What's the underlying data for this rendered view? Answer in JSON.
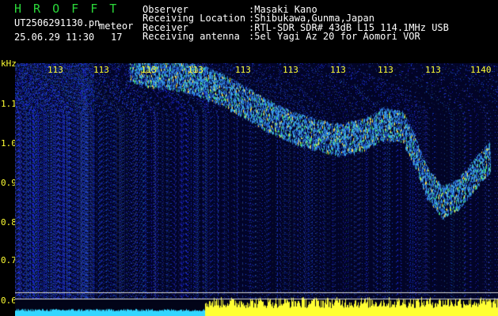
{
  "header": {
    "logo": "H R O F F T",
    "file_name": "UT2506291130.pn",
    "file_suffix": "meteor",
    "date_time": "25.06.29 11:30",
    "count": "17",
    "info": [
      {
        "label": "Observer",
        "value": ":Masaki Kano"
      },
      {
        "label": "Receiving Location",
        "value": ":Shibukawa,Gunma,Japan"
      },
      {
        "label": "Receiver",
        "value": ":RTL-SDR SDR# 43dB L15 114.1MHz USB"
      },
      {
        "label": "Receiving antenna",
        "value": ":5el Yagi Az 20 for Aomori VOR"
      }
    ]
  },
  "y_axis": {
    "unit": "kHz",
    "ticks": [
      "1.1",
      "1.0",
      "0.9",
      "0.8",
      "0.7",
      "0.6"
    ]
  },
  "x_axis": {
    "ticks": [
      "113",
      "113",
      "113",
      "113",
      "113",
      "113",
      "113",
      "113",
      "113",
      "1140"
    ]
  },
  "colors": {
    "background": "#000000",
    "noise_base": "#050a3a",
    "signal": "#3da8e8",
    "amplitude": "#ffff33",
    "amplitude_low": "#33d6ff",
    "logo": "#2bd83a"
  }
}
